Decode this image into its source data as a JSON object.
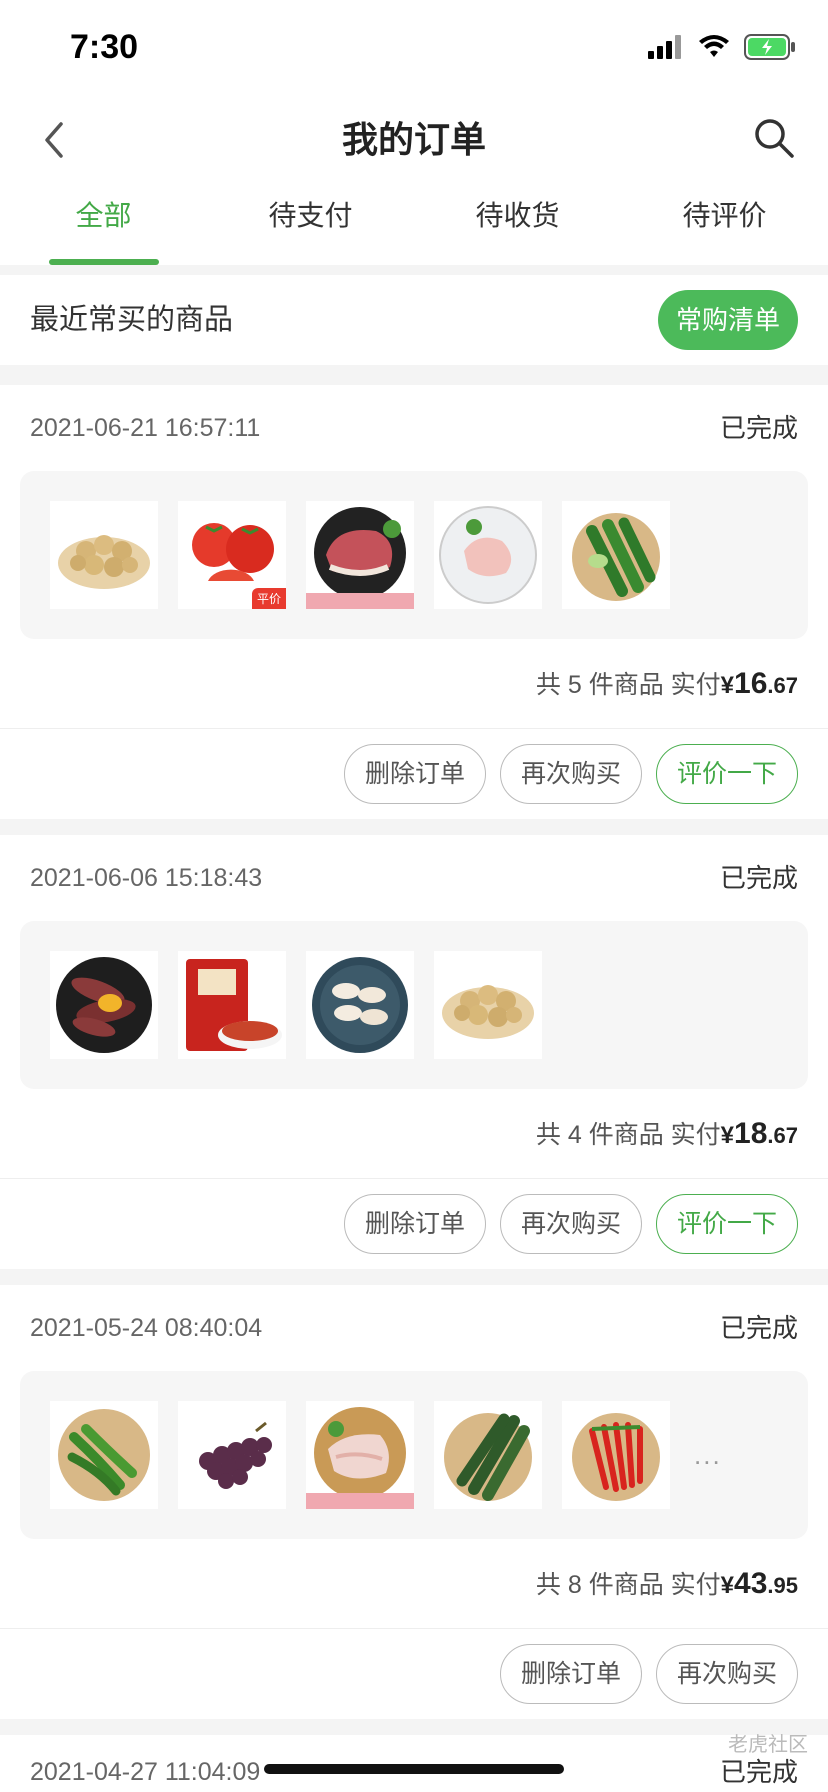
{
  "status": {
    "time": "7:30"
  },
  "header": {
    "title": "我的订单"
  },
  "tabs": [
    {
      "label": "全部",
      "active": true
    },
    {
      "label": "待支付",
      "active": false
    },
    {
      "label": "待收货",
      "active": false
    },
    {
      "label": "待评价",
      "active": false
    }
  ],
  "recent": {
    "title": "最近常买的商品",
    "button": "常购清单"
  },
  "orders": [
    {
      "date": "2021-06-21 16:57:11",
      "status": "已完成",
      "items": [
        "potatoes",
        "tomatoes",
        "pork",
        "chicken-breast",
        "cucumbers"
      ],
      "count_text": "共 5 件商品",
      "paid_label": "实付",
      "currency": "¥",
      "amount_int": "16",
      "amount_dec": ".67",
      "actions": [
        "删除订单",
        "再次购买",
        "评价一下"
      ]
    },
    {
      "date": "2021-06-06 15:18:43",
      "status": "已完成",
      "items": [
        "sweet-potatoes",
        "chili-powder-pack",
        "chicken-wings",
        "potatoes"
      ],
      "count_text": "共 4 件商品",
      "paid_label": "实付",
      "currency": "¥",
      "amount_int": "18",
      "amount_dec": ".67",
      "actions": [
        "删除订单",
        "再次购买",
        "评价一下"
      ]
    },
    {
      "date": "2021-05-24 08:40:04",
      "status": "已完成",
      "items": [
        "green-peppers",
        "grapes",
        "pork-belly",
        "cucumbers",
        "red-chilies"
      ],
      "more": "...",
      "count_text": "共 8 件商品",
      "paid_label": "实付",
      "currency": "¥",
      "amount_int": "43",
      "amount_dec": ".95",
      "actions": [
        "删除订单",
        "再次购买"
      ]
    },
    {
      "date": "2021-04-27 11:04:09",
      "status": "已完成"
    }
  ],
  "badges": {
    "pingjia": "平价"
  },
  "watermark": "老虎社区",
  "colors": {
    "accent": "#4caf50",
    "button_green": "#4cba5a"
  }
}
